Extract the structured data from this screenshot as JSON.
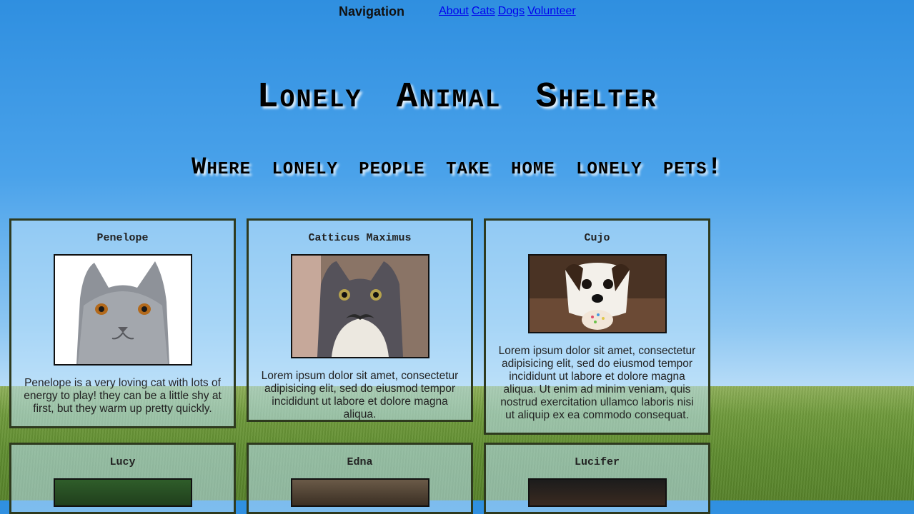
{
  "nav": {
    "title": "Navigation",
    "links": [
      "About",
      "Cats",
      "Dogs",
      "Volunteer"
    ]
  },
  "header": {
    "title": "Lonely Animal Shelter",
    "subtitle": "Where lonely people take home lonely pets!"
  },
  "pets": [
    {
      "name": "Penelope",
      "description": "Penelope is a very loving cat with lots of energy to play! they can be a little shy at first, but they warm up pretty quickly."
    },
    {
      "name": "Catticus Maximus",
      "description": "Lorem ipsum dolor sit amet, consectetur adipisicing elit, sed do eiusmod tempor incididunt ut labore et dolore magna aliqua."
    },
    {
      "name": "Cujo",
      "description": "Lorem ipsum dolor sit amet, consectetur adipisicing elit, sed do eiusmod tempor incididunt ut labore et dolore magna aliqua. Ut enim ad minim veniam, quis nostrud exercitation ullamco laboris nisi ut aliquip ex ea commodo consequat."
    },
    {
      "name": "Lucy"
    },
    {
      "name": "Edna"
    },
    {
      "name": "Lucifer"
    }
  ]
}
